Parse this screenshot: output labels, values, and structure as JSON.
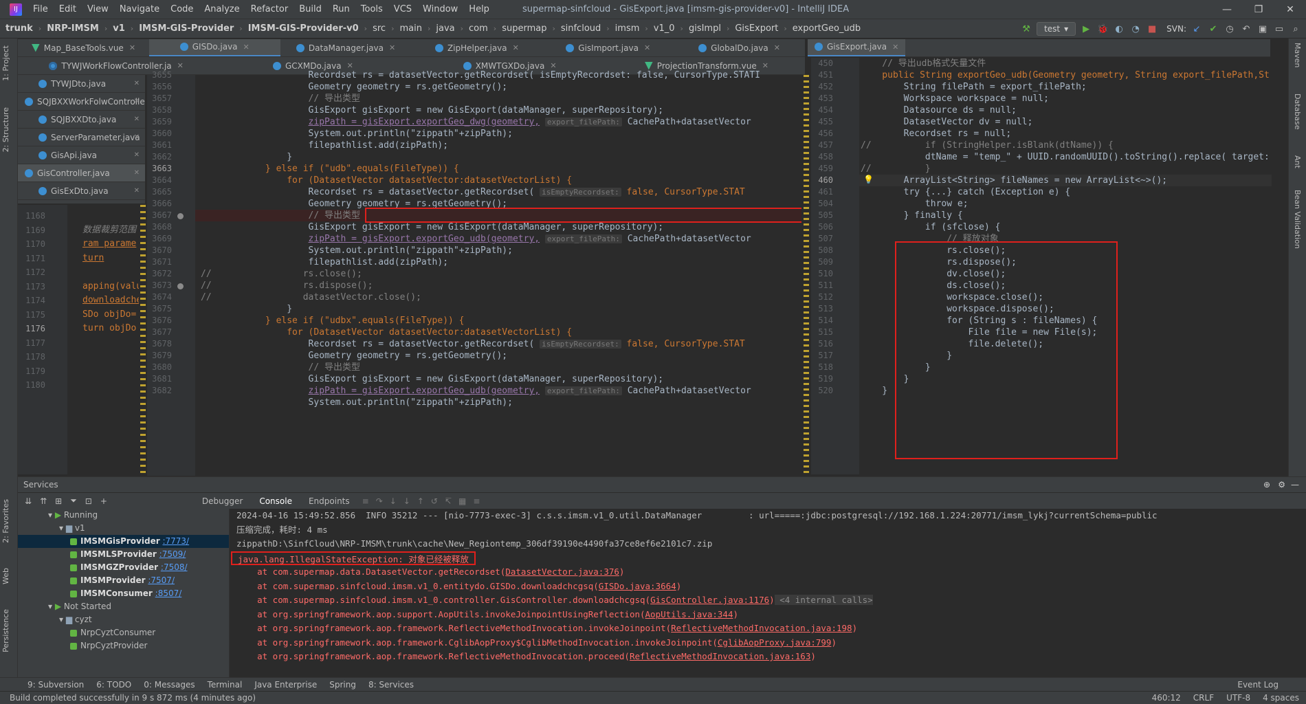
{
  "window": {
    "title": "supermap-sinfcloud - GisExport.java [imsm-gis-provider-v0] - IntelliJ IDEA",
    "menus": [
      "File",
      "Edit",
      "View",
      "Navigate",
      "Code",
      "Analyze",
      "Refactor",
      "Build",
      "Run",
      "Tools",
      "VCS",
      "Window",
      "Help"
    ],
    "controls": [
      "—",
      "❐",
      "✕"
    ]
  },
  "breadcrumb": [
    "trunk",
    "NRP-IMSM",
    "v1",
    "IMSM-GIS-Provider",
    "IMSM-GIS-Provider-v0",
    "src",
    "main",
    "java",
    "com",
    "supermap",
    "sinfcloud",
    "imsm",
    "v1_0",
    "gisImpl",
    "GisExport",
    "exportGeo_udb"
  ],
  "run_config": "test",
  "svn_label": "SVN:",
  "left_vtabs": [
    "1: Project",
    "2: Structure",
    "2: Favorites",
    "Web",
    "Persistence"
  ],
  "right_vtabs": [
    "Maven",
    "Database",
    "Ant",
    "Bean Validation"
  ],
  "tabs_row1_left": [
    {
      "label": "Map_BaseTools.vue",
      "type": "vue"
    },
    {
      "label": "GISDo.java",
      "type": "java",
      "active": true
    },
    {
      "label": "DataManager.java",
      "type": "java"
    },
    {
      "label": "ZipHelper.java",
      "type": "java"
    },
    {
      "label": "GisImport.java",
      "type": "java"
    },
    {
      "label": "GlobalDo.java",
      "type": "java"
    }
  ],
  "tabs_row2_left": [
    {
      "label": "TYWJWorkFlowController.ja",
      "type": "ctl"
    },
    {
      "label": "GCXMDo.java",
      "type": "java"
    },
    {
      "label": "XMWTGXDo.java",
      "type": "java"
    },
    {
      "label": "ProjectionTransform.vue",
      "type": "vue"
    }
  ],
  "tab_right_active": "GisExport.java",
  "left_file_list": [
    "TYWJDto.java",
    "SQJBXXWorkFolwController",
    "SQJBXXDto.java",
    "ServerParameter.java",
    "GisApi.java",
    "GisController.java",
    "GisExDto.java"
  ],
  "side_editor": {
    "line_numbers": [
      "1168",
      "1169",
      "1170",
      "1171",
      "1172",
      "1173",
      "1174",
      "1175",
      "1176",
      "1177",
      "1178",
      "1179",
      "1180"
    ],
    "lines": [
      "",
      "数据裁剪范围",
      "ram parame",
      "turn",
      "",
      "apping(value",
      "downloadche",
      "SDo objDo=",
      "turn objDo",
      "",
      "",
      "",
      ""
    ]
  },
  "center_editor": {
    "line_numbers": [
      "3655",
      "3656",
      "3657",
      "3658",
      "3659",
      "3660",
      "3661",
      "3662",
      "3663",
      "3664",
      "3665",
      "3666",
      "3667",
      "3668",
      "3669",
      "3670",
      "3671",
      "3672",
      "3673",
      "3674",
      "3675",
      "3676",
      "3677",
      "3678",
      "3679",
      "3680",
      "3681",
      "3682"
    ],
    "first_line": "                    Recordset rs = datasetVector.getRecordset( isEmptyRecordset: false, CursorType.STATI",
    "l_geom": "Geometry geometry = rs.getGeometry();",
    "l_comment": "// 导出类型",
    "l_gisexport": "GisExport gisExport = new GisExport(dataManager, superRepository);",
    "l_zip_dwg": "zipPath = gisExport.exportGeo_dwg(geometry,",
    "l_zip_udb": "zipPath = gisExport.exportGeo_udb(geometry,",
    "hint_filepath": "export_filePath:",
    "l_zip_tail": "CachePath+datasetVector",
    "l_println": "System.out.println(\"zippath\"+zipPath);",
    "l_add": "filepathlist.add(zipPath);",
    "l_close_brace": "}",
    "l_else_udb": "} else if (\"udb\".equals(FileType)) {",
    "l_else_udbx": "} else if (\"udbx\".equals(FileType)) {",
    "l_for": "for (DatasetVector datasetVector:datasetVectorList) {",
    "l_recordset": "Recordset rs = datasetVector.getRecordset(",
    "hint_empty": "isEmptyRecordset:",
    "l_recordset_tail": "false, CursorType.STAT",
    "l_rs_close": "rs.close();",
    "l_rs_dispose": "rs.dispose();",
    "l_dv_close": "datasetVector.close();",
    "comment_marks": "//"
  },
  "right_editor": {
    "line_numbers": [
      "450",
      "451",
      "452",
      "453",
      "454",
      "455",
      "456",
      "457",
      "458",
      "459",
      "460",
      "461",
      "504",
      "505",
      "506",
      "507",
      "508",
      "509",
      "510",
      "511",
      "512",
      "513",
      "514",
      "515",
      "516",
      "517",
      "518",
      "519",
      "520"
    ],
    "lines": [
      "    // 导出udb格式矢量文件",
      "    public String exportGeo_udb(Geometry geometry, String export_filePath,String",
      "        String filePath = export_filePath;",
      "        Workspace workspace = null;",
      "        Datasource ds = null;",
      "        DatasetVector dv = null;",
      "        Recordset rs = null;",
      "//          if (StringHelper.isBlank(dtName)) {",
      "            dtName = \"temp_\" + UUID.randomUUID().toString().replace( target: \"-\",",
      "//          }",
      "        ArrayList<String> fileNames = new ArrayList<~>();",
      "        try {...} catch (Exception e) {",
      "            throw e;",
      "        } finally {",
      "            if (sfclose) {",
      "                // 释放对象",
      "                rs.close();",
      "                rs.dispose();",
      "                dv.close();",
      "                ds.close();",
      "                workspace.close();",
      "                workspace.dispose();",
      "                for (String s : fileNames) {",
      "                    File file = new File(s);",
      "                    file.delete();",
      "                }",
      "            }",
      "        }",
      "    }"
    ]
  },
  "services": {
    "title": "Services",
    "subtabs": [
      "Debugger",
      "Console",
      "Endpoints"
    ],
    "tree": [
      {
        "label": "Running",
        "indent": 1,
        "kind": "group"
      },
      {
        "label": "v1",
        "indent": 2,
        "kind": "folder"
      },
      {
        "label": "IMSMGisProvider",
        "port": ":7773/",
        "indent": 3,
        "kind": "leaf",
        "selected": true
      },
      {
        "label": "IMSMLSProvider",
        "port": ":7509/",
        "indent": 3,
        "kind": "leaf"
      },
      {
        "label": "IMSMGZProvider",
        "port": ":7508/",
        "indent": 3,
        "kind": "leaf"
      },
      {
        "label": "IMSMProvider",
        "port": ":7507/",
        "indent": 3,
        "kind": "leaf"
      },
      {
        "label": "IMSMConsumer",
        "port": ":8507/",
        "indent": 3,
        "kind": "leaf"
      },
      {
        "label": "Not Started",
        "indent": 1,
        "kind": "group"
      },
      {
        "label": "cyzt",
        "indent": 2,
        "kind": "folder"
      },
      {
        "label": "NrpCyztConsumer",
        "indent": 3,
        "kind": "plain"
      },
      {
        "label": "NrpCyztProvider",
        "indent": 3,
        "kind": "plain"
      }
    ],
    "console": [
      {
        "text": "2024-04-16 15:49:52.856  INFO 35212 --- [nio-7773-exec-3] c.s.s.imsm.v1_0.util.DataManager         : url=====:jdbc:postgresql://192.168.1.224:20771/imsm_lykj?currentSchema=public",
        "cls": ""
      },
      {
        "text": "压缩完成，耗时: 4 ms",
        "cls": ""
      },
      {
        "text": "zippathD:\\SinfCloud\\NRP-IMSM\\trunk\\cache\\New_Regiontemp_306df39190e4490fa37ce8ef6e2101c7.zip",
        "cls": ""
      },
      {
        "text": "java.lang.IllegalStateException: 对象已经被释放",
        "cls": "err"
      },
      {
        "text": "    at com.supermap.data.DatasetVector.getRecordset(",
        "link": "DatasetVector.java:376",
        "tail": ")",
        "cls": "err"
      },
      {
        "text": "    at com.supermap.sinfcloud.imsm.v1_0.entitydo.GISDo.downloadchcgsq(",
        "link": "GISDo.java:3664",
        "tail": ")",
        "cls": "err"
      },
      {
        "text": "    at com.supermap.sinfcloud.imsm.v1_0.controller.GisController.downloadchcgsq(",
        "link": "GisController.java:1176",
        "tail": ")",
        "internal": " <4 internal calls>",
        "cls": "err"
      },
      {
        "text": "    at org.springframework.aop.support.AopUtils.invokeJoinpointUsingReflection(",
        "link": "AopUtils.java:344",
        "tail": ")",
        "cls": "err"
      },
      {
        "text": "    at org.springframework.aop.framework.ReflectiveMethodInvocation.invokeJoinpoint(",
        "link": "ReflectiveMethodInvocation.java:198",
        "tail": ")",
        "cls": "err"
      },
      {
        "text": "    at org.springframework.aop.framework.CglibAopProxy$CglibMethodInvocation.invokeJoinpoint(",
        "link": "CglibAopProxy.java:799",
        "tail": ")",
        "cls": "err"
      },
      {
        "text": "    at org.springframework.aop.framework.ReflectiveMethodInvocation.proceed(",
        "link": "ReflectiveMethodInvocation.java:163",
        "tail": ")",
        "cls": "err"
      }
    ]
  },
  "bottom_tools": [
    "9: Subversion",
    "6: TODO",
    "0: Messages",
    "Terminal",
    "Java Enterprise",
    "Spring",
    "8: Services"
  ],
  "event_log": "Event Log",
  "status": {
    "message": "Build completed successfully in 9 s 872 ms (4 minutes ago)",
    "position": "460:12",
    "line_sep": "CRLF",
    "encoding": "UTF-8",
    "indent": "4 spaces"
  },
  "colors": {
    "error": "#ff6b68",
    "accent": "#4a88c7",
    "redbox": "#e0201c"
  }
}
